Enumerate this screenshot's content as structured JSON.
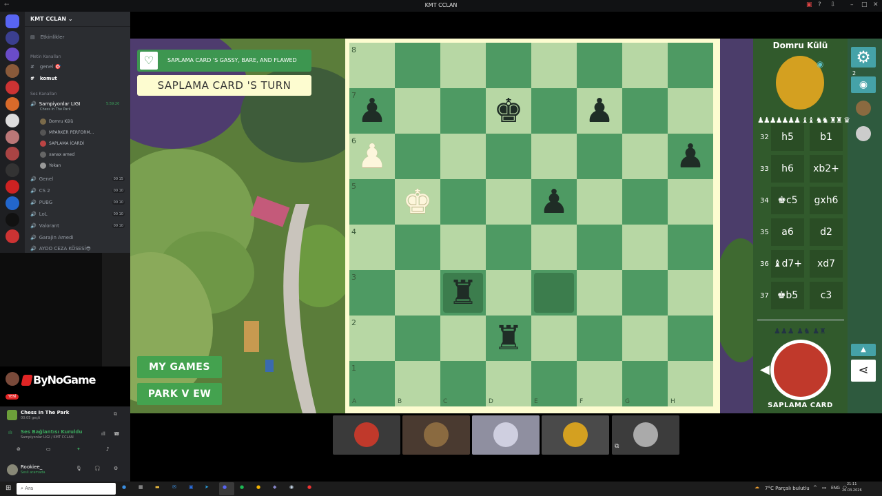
{
  "window": {
    "title": "KMT CCLAN"
  },
  "discord": {
    "server_name": "KMT CCLAN",
    "events_label": "Etkinlikler",
    "text_category": "Metin Kanalları",
    "text_channels": [
      "genel 🎯",
      "komut"
    ],
    "voice_category": "Ses Kanalları",
    "active_channel": {
      "name": "Sampiyonlar LIGI",
      "activity": "Chess In The Park",
      "time": "5:59:20"
    },
    "voice_users": [
      "Domru Külü",
      "MPARKER PERFORM...",
      "SAPLAMA İCARDİ",
      "xanax amed",
      "Yokan"
    ],
    "voice_channels": [
      {
        "name": "Genel",
        "c1": "00",
        "c2": "15"
      },
      {
        "name": "CS 2",
        "c1": "00",
        "c2": "10"
      },
      {
        "name": "PUBG",
        "c1": "00",
        "c2": "10"
      },
      {
        "name": "LoL",
        "c1": "00",
        "c2": "10"
      },
      {
        "name": "Valorant",
        "c1": "00",
        "c2": "10"
      },
      {
        "name": "Garajin Amedi",
        "c1": "",
        "c2": ""
      },
      {
        "name": "AYDO CEZA KÖSESİ😎",
        "c1": "",
        "c2": ""
      }
    ],
    "brand": "ByNoGame",
    "brand_badge": "YENİ",
    "activity_title": "Chess In The Park",
    "activity_sub": "00:05 geçti",
    "voice_status": "Ses Bağlantısı Kuruldu",
    "voice_location": "Sampiyonlar LIGI / KMT CCLAN",
    "user_name": "Rookiee_",
    "user_status": "Sesli aramada"
  },
  "game": {
    "message": "SAPLAMA CARD 'S GASSY, BARE, AND FLAWED",
    "turn": "SAPLAMA CARD 'S TURN",
    "my_games": "MY GAMES",
    "park_view": "PARK V EW",
    "ranks": [
      "8",
      "7",
      "6",
      "5",
      "4",
      "3",
      "2",
      "1"
    ],
    "files": [
      "A",
      "B",
      "C",
      "D",
      "E",
      "F",
      "G",
      "H"
    ],
    "opponent_name": "Domru Külü",
    "player_name": "SAPLAMA CARD",
    "captured_top": "♟♟♟♟♟♟♟ ♝♝ ♞♞ ♜♜ ♛",
    "captured_bottom": "♟♟♟ ♟♞ ♟♜",
    "moves": [
      {
        "n": "32",
        "w": "h5",
        "b": "b1"
      },
      {
        "n": "33",
        "w": "h6",
        "b": "xb2+"
      },
      {
        "n": "34",
        "w": "♚c5",
        "b": "gxh6"
      },
      {
        "n": "35",
        "w": "a6",
        "b": "d2"
      },
      {
        "n": "36",
        "w": "♝d7+",
        "b": "xd7"
      },
      {
        "n": "37",
        "w": "♚b5",
        "b": "c3"
      }
    ],
    "watchers_count": "2",
    "pieces": [
      {
        "sq": "a7",
        "p": "♟",
        "c": "black"
      },
      {
        "sq": "d7",
        "p": "♚",
        "c": "black"
      },
      {
        "sq": "f7",
        "p": "♟",
        "c": "black"
      },
      {
        "sq": "a6",
        "p": "♟",
        "c": "white"
      },
      {
        "sq": "h6",
        "p": "♟",
        "c": "black"
      },
      {
        "sq": "b5",
        "p": "♚",
        "c": "white"
      },
      {
        "sq": "e5",
        "p": "♟",
        "c": "black"
      },
      {
        "sq": "c3",
        "p": "♜",
        "c": "black"
      },
      {
        "sq": "d2",
        "p": "♜",
        "c": "black"
      }
    ],
    "highlights": [
      "c3",
      "e3"
    ]
  },
  "taskbar": {
    "search": "Ara",
    "weather": "7°C  Parçalı bulutlu",
    "lang": "ENG",
    "time": "21:11",
    "date": "26.03.2026"
  },
  "colors": {
    "light_square": "#b7d7a4",
    "dark_square": "#4e9a63",
    "board_frame": "#fdfcd0",
    "accent_green": "#44a24f",
    "tool_teal": "#45a2a8"
  }
}
